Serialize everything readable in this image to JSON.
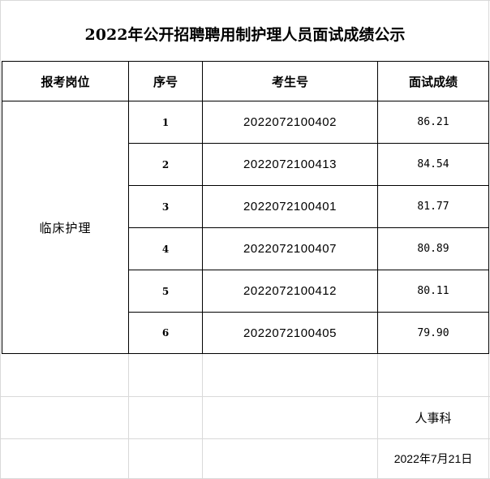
{
  "title": "2022年公开招聘聘用制护理人员面试成绩公示",
  "headers": {
    "position": "报考岗位",
    "seq": "序号",
    "exam_no": "考生号",
    "score": "面试成绩"
  },
  "position_value": "临床护理",
  "rows": [
    {
      "seq": "1",
      "exam_no": "2022072100402",
      "score": "86.21"
    },
    {
      "seq": "2",
      "exam_no": "2022072100413",
      "score": "84.54"
    },
    {
      "seq": "3",
      "exam_no": "2022072100401",
      "score": "81.77"
    },
    {
      "seq": "4",
      "exam_no": "2022072100407",
      "score": "80.89"
    },
    {
      "seq": "5",
      "exam_no": "2022072100412",
      "score": "80.11"
    },
    {
      "seq": "6",
      "exam_no": "2022072100405",
      "score": "79.90"
    }
  ],
  "footer": {
    "department": "人事科",
    "date": "2022年7月21日"
  }
}
